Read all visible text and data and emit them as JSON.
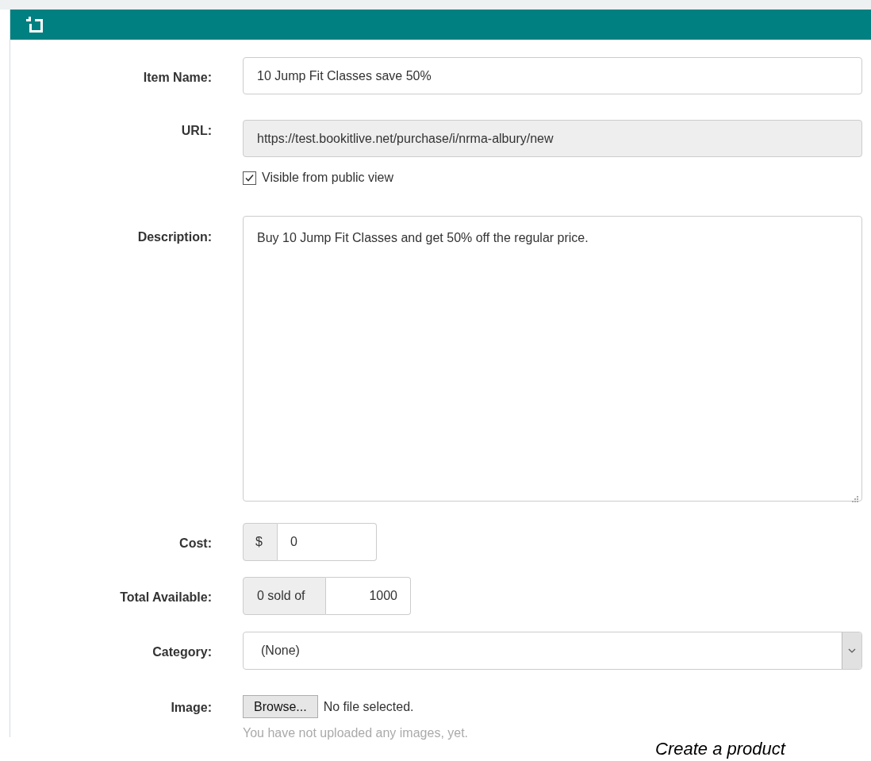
{
  "form": {
    "fields": [
      {
        "kind": "text",
        "label": "Item Name:",
        "value": "10 Jump Fit Classes save 50%"
      },
      {
        "kind": "url",
        "label": "URL:",
        "value": "https://test.bookitlive.net/purchase/i/nrma-albury/new",
        "checkbox": {
          "label": "Visible from public view",
          "checked": true
        }
      },
      {
        "kind": "textarea",
        "label": "Description:",
        "value": "Buy 10 Jump Fit Classes and get 50% off the regular price."
      },
      {
        "kind": "money",
        "label": "Cost:",
        "prefix": "$",
        "value": "0"
      },
      {
        "kind": "stock",
        "label": "Total Available:",
        "prefix": "0 sold of",
        "value": "1000"
      },
      {
        "kind": "select",
        "label": "Category:",
        "value": "(None)"
      },
      {
        "kind": "file",
        "label": "Image:",
        "button": "Browse...",
        "status": "No file selected.",
        "help": "You have not uploaded any images, yet."
      }
    ]
  },
  "caption": "Create a product"
}
